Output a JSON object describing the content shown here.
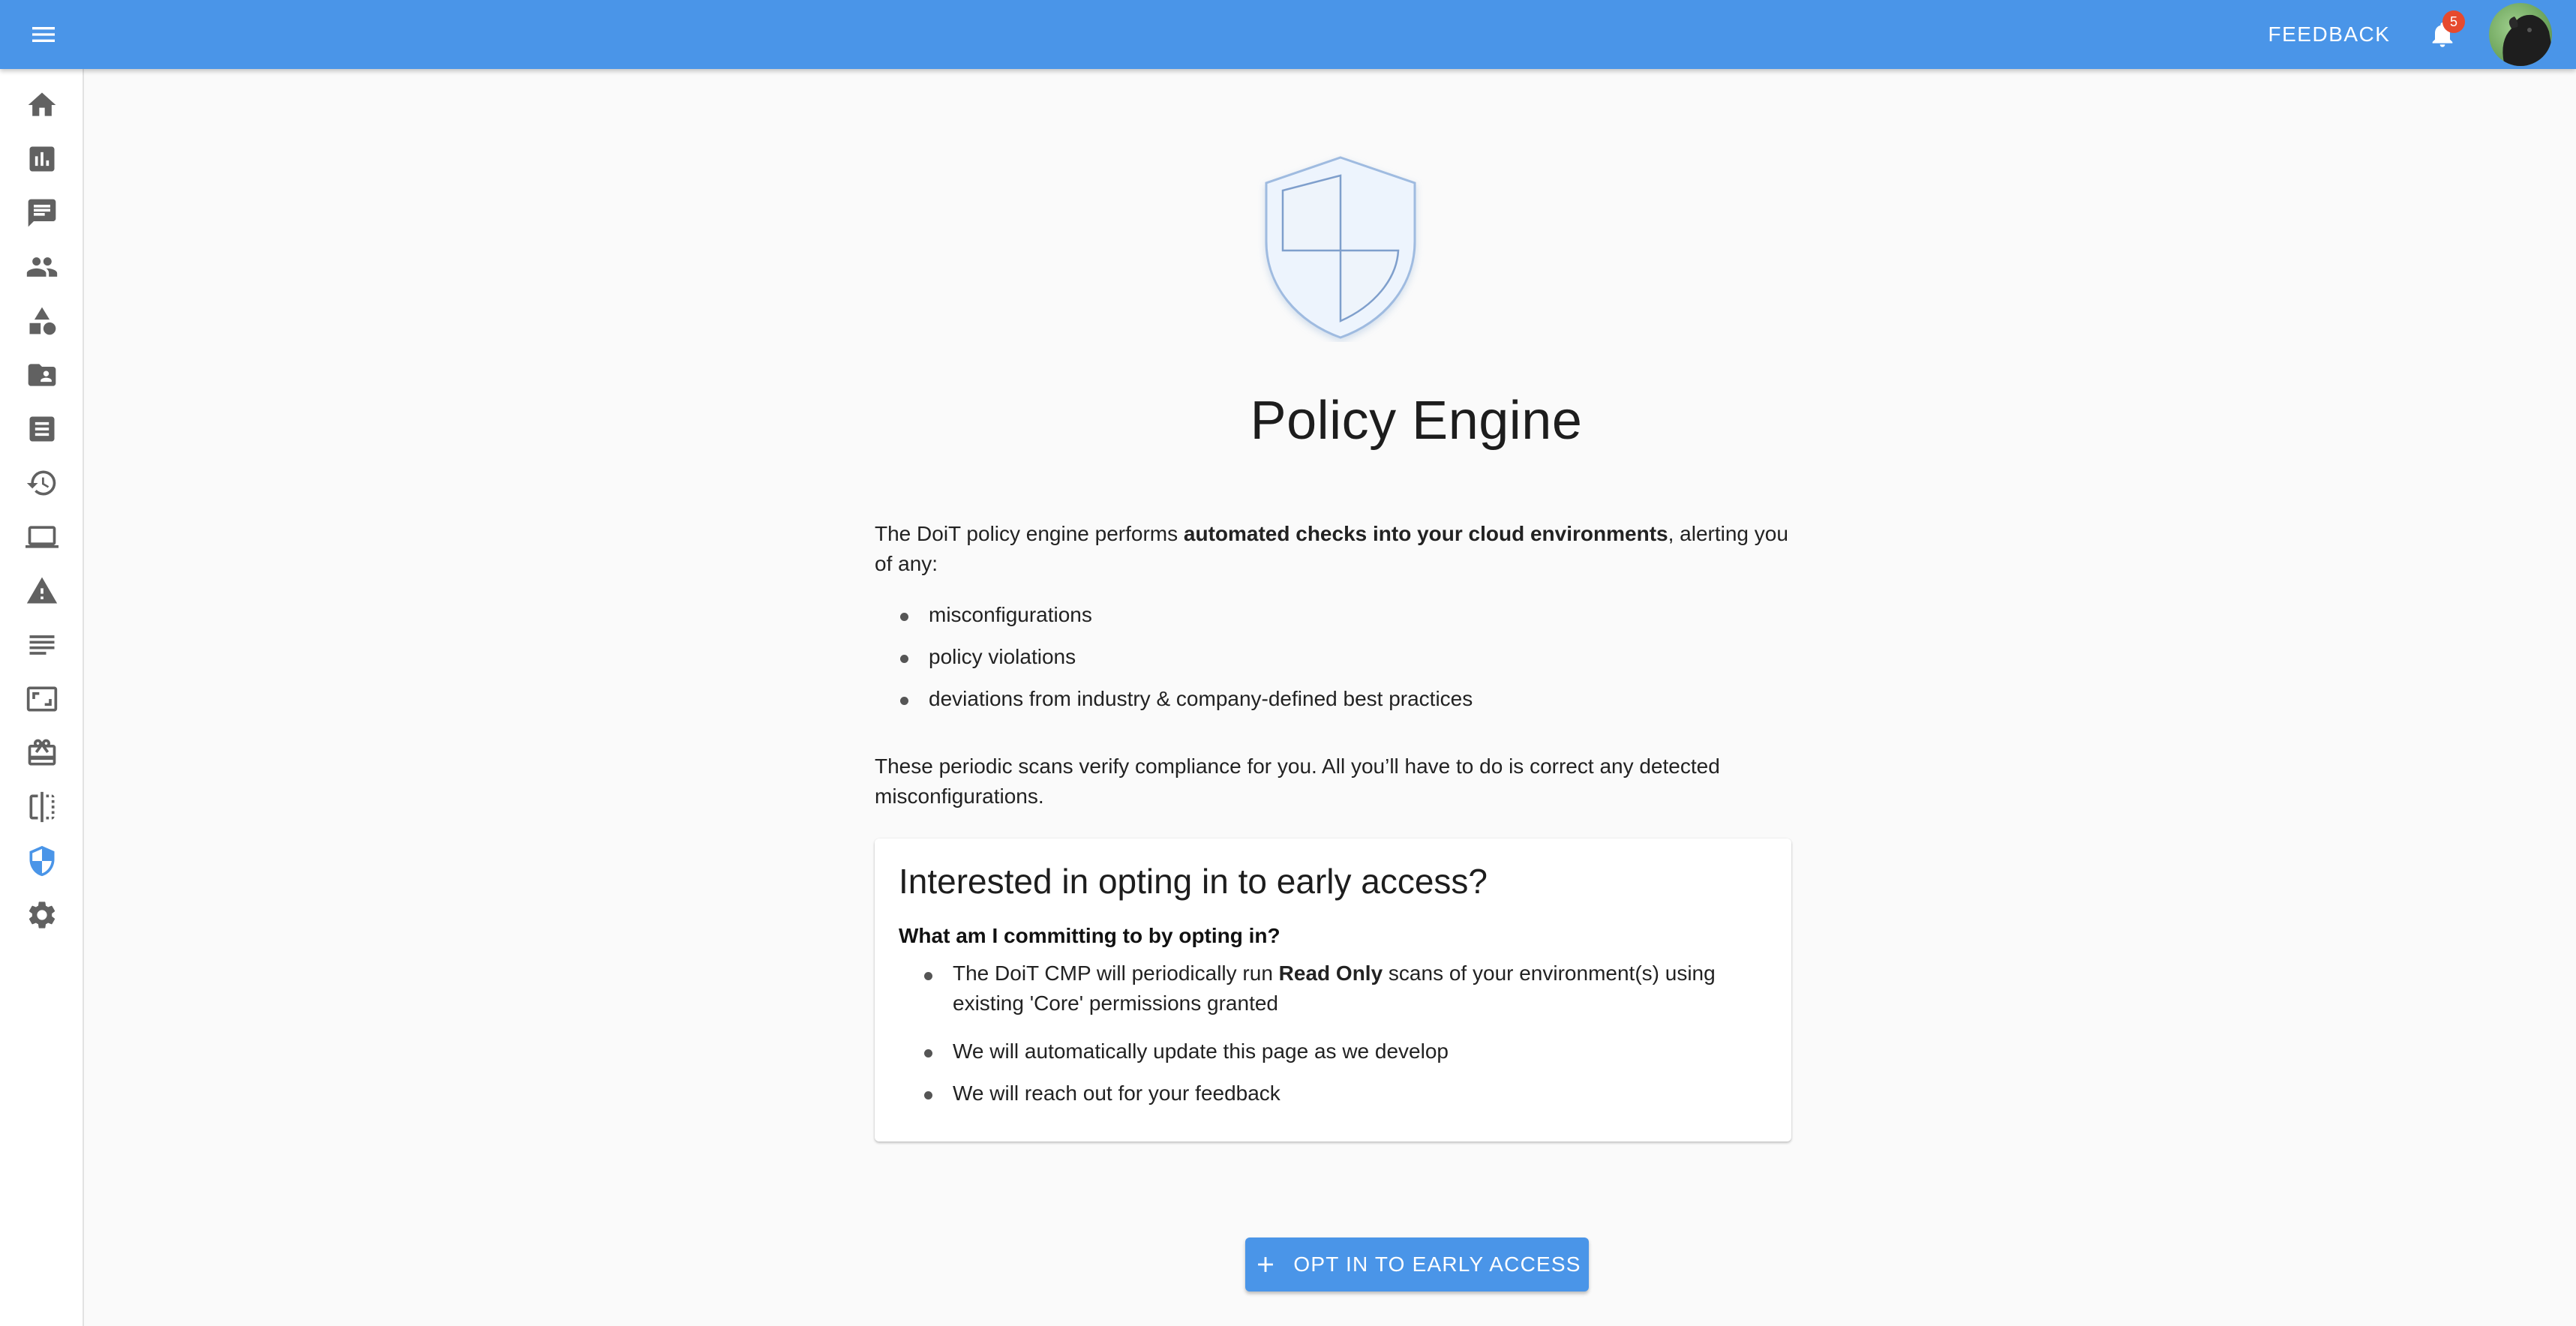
{
  "colors": {
    "appbar": "#4a95e8",
    "accent": "#4a95e8",
    "badge": "#e64a2e",
    "sidebar_icon": "#616161",
    "sidebar_icon_active": "#4a95e8"
  },
  "header": {
    "menu_icon": "menu-icon",
    "feedback_label": "FEEDBACK",
    "notifications_icon": "bell-icon",
    "notification_count": "5",
    "avatar": "user-avatar"
  },
  "sidebar": {
    "items": [
      {
        "icon": "home-icon"
      },
      {
        "icon": "analytics-icon"
      },
      {
        "icon": "chat-icon"
      },
      {
        "icon": "people-icon"
      },
      {
        "icon": "shapes-icon"
      },
      {
        "icon": "contact-folder-icon"
      },
      {
        "icon": "list-document-icon"
      },
      {
        "icon": "history-icon"
      },
      {
        "icon": "laptop-icon"
      },
      {
        "icon": "warning-icon"
      },
      {
        "icon": "notes-icon"
      },
      {
        "icon": "aspect-ratio-icon"
      },
      {
        "icon": "card-giftcard-icon"
      },
      {
        "icon": "flip-icon"
      },
      {
        "icon": "shield-icon",
        "active": true
      },
      {
        "icon": "gear-icon"
      }
    ]
  },
  "page": {
    "title": "Policy Engine",
    "intro_pre": "The DoiT policy engine performs ",
    "intro_bold": "automated checks into your cloud environments",
    "intro_post": ", alerting you of any:",
    "bullets": [
      "misconfigurations",
      "policy violations",
      "deviations from industry & company-defined best practices"
    ],
    "outro": "These periodic scans verify compliance for you. All you’ll have to do is correct any detected misconfigurations."
  },
  "card": {
    "title": "Interested in opting in to early access?",
    "subtitle": "What am I committing to by opting in?",
    "item1_pre": "The DoiT CMP will periodically run ",
    "item1_bold": "Read Only",
    "item1_post": " scans of your environment(s) using existing 'Core' permissions granted",
    "item2": "We will automatically update this page as we develop",
    "item3": "We will reach out for your feedback"
  },
  "cta": {
    "icon": "plus-icon",
    "label": "OPT IN TO EARLY ACCESS"
  }
}
